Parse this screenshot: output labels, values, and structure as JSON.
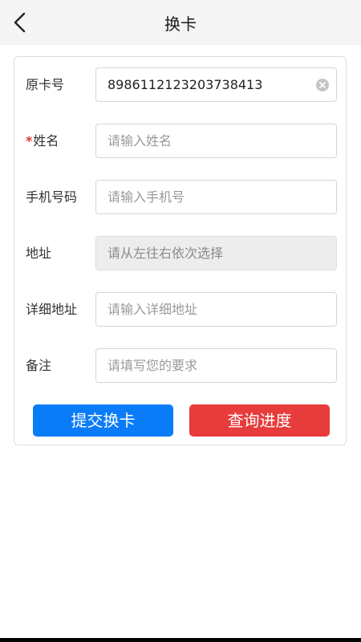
{
  "header": {
    "title": "换卡",
    "back_icon": "chevron-left-icon"
  },
  "form": {
    "original_card": {
      "label": "原卡号",
      "value": "8986112123203738413",
      "clear_icon": "clear-circle-icon"
    },
    "name": {
      "required_mark": "*",
      "label": "姓名",
      "placeholder": "请输入姓名"
    },
    "phone": {
      "label": "手机号码",
      "placeholder": "请输入手机号"
    },
    "address": {
      "label": "地址",
      "placeholder": "请从左往右依次选择"
    },
    "detail_address": {
      "label": "详细地址",
      "placeholder": "请输入详细地址"
    },
    "remark": {
      "label": "备注",
      "placeholder": "请填写您的要求"
    }
  },
  "actions": {
    "submit_label": "提交换卡",
    "query_label": "查询进度"
  },
  "colors": {
    "submit_bg": "#0a7cf8",
    "query_bg": "#e83b3b",
    "header_bg": "#f5f5f5",
    "disabled_bg": "#ededed",
    "required": "#e53935"
  }
}
